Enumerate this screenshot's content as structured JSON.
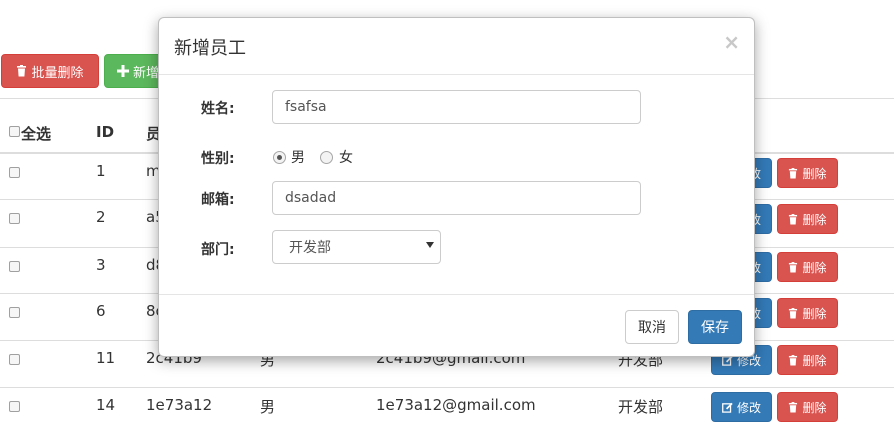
{
  "toolbar": {
    "batch_delete_label": "批量删除",
    "add_label": "新增"
  },
  "table": {
    "headers": {
      "select_all": "全选",
      "id": "ID",
      "name": "员"
    },
    "rows": [
      {
        "id": "1",
        "name": "m",
        "gender": "",
        "email": "",
        "dept": ""
      },
      {
        "id": "2",
        "name": "a5",
        "gender": "",
        "email": "",
        "dept": ""
      },
      {
        "id": "3",
        "name": "d8",
        "gender": "",
        "email": "",
        "dept": ""
      },
      {
        "id": "6",
        "name": "8c",
        "gender": "",
        "email": "",
        "dept": ""
      },
      {
        "id": "11",
        "name": "2c41b9",
        "gender": "男",
        "email": "2c41b9@gmail.com",
        "dept": "开发部"
      },
      {
        "id": "14",
        "name": "1e73a12",
        "gender": "男",
        "email": "1e73a12@gmail.com",
        "dept": "开发部"
      }
    ],
    "edit_label": "修改",
    "edit_partial_label": "改",
    "delete_label": "删除"
  },
  "modal": {
    "title": "新增员工",
    "close_symbol": "×",
    "name_label": "姓名:",
    "name_value": "fsafsa",
    "gender_label": "性别:",
    "gender_options": [
      "男",
      "女"
    ],
    "gender_selected": "男",
    "email_label": "邮箱:",
    "email_value": "dsadad",
    "dept_label": "部门:",
    "dept_value": "开发部",
    "cancel_label": "取消",
    "save_label": "保存"
  },
  "colors": {
    "danger": "#d9534f",
    "success": "#5cb85c",
    "primary": "#337ab7"
  }
}
